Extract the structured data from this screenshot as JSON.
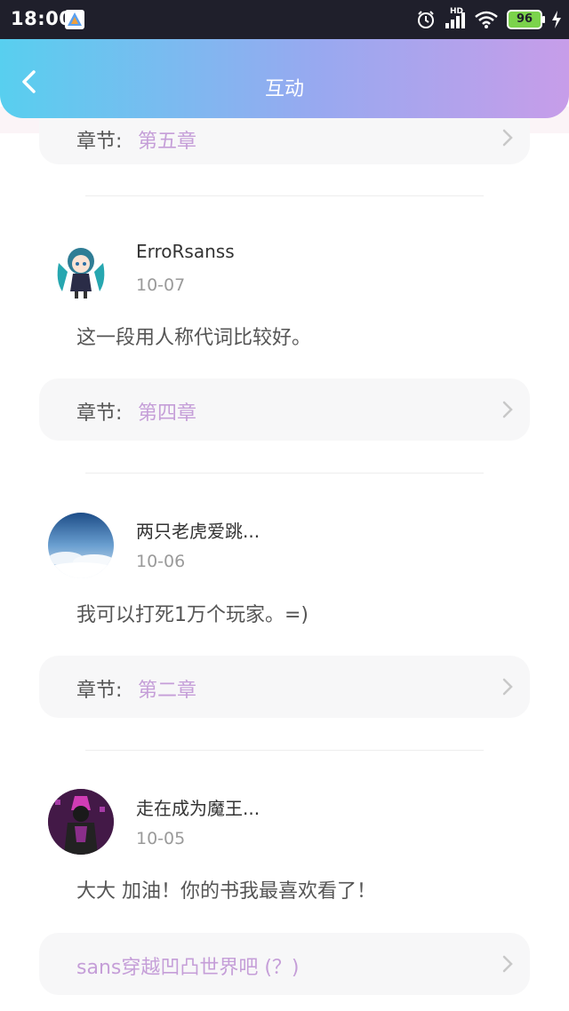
{
  "status": {
    "time": "18:00",
    "battery": "96",
    "network": "HD"
  },
  "header": {
    "title": "互动"
  },
  "comments": [
    {
      "username": "ErroRsanss",
      "date": "10-07",
      "text": "这一段用人称代词比较好。",
      "chapter_label": "章节:",
      "chapter": "第四章"
    },
    {
      "username": "两只老虎爱跳...",
      "date": "10-06",
      "text": "我可以打死1万个玩家。=)",
      "chapter_label": "章节:",
      "chapter": "第二章"
    },
    {
      "username": "走在成为魔王...",
      "date": "10-05",
      "text": "大大 加油！你的书我最喜欢看了！",
      "chapter_full": "sans穿越凹凸世界吧 (？)"
    }
  ],
  "partial_card": {
    "chapter_label": "章节:",
    "chapter": "第五章"
  },
  "colors": {
    "accent": "#c59ed8",
    "header_start": "#58cfef",
    "header_end": "#c79de9"
  }
}
